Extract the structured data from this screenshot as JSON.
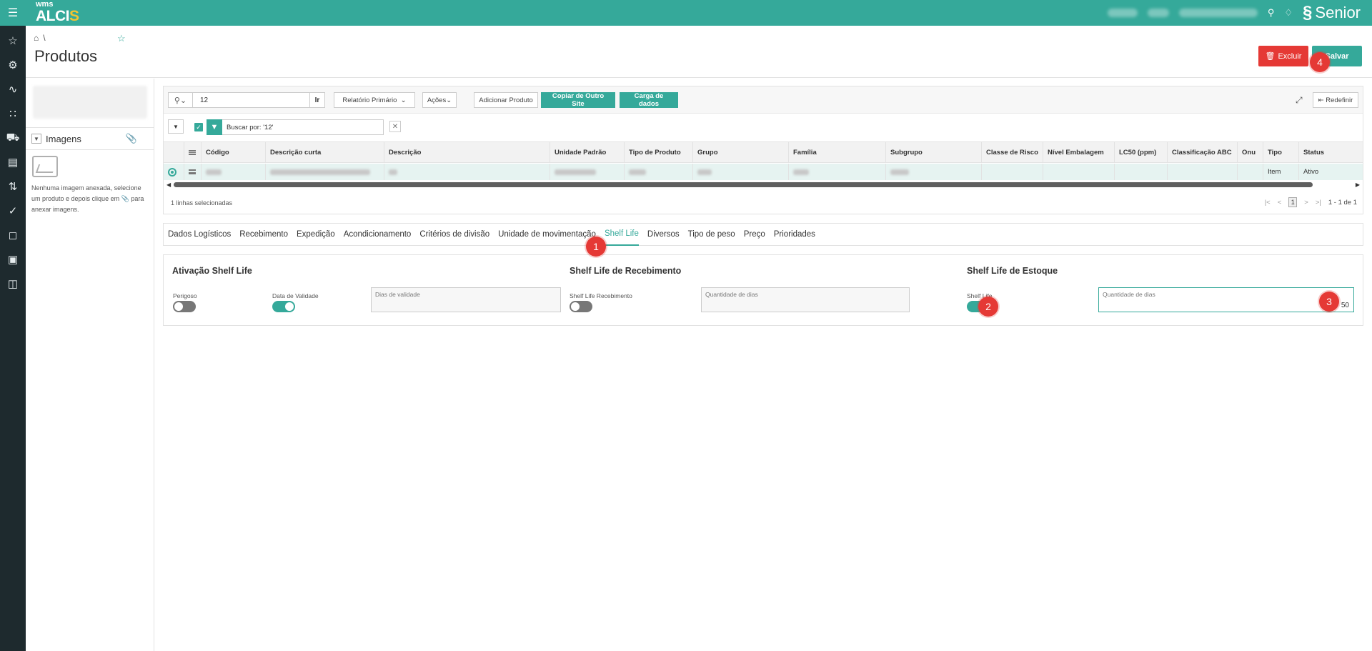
{
  "app": {
    "logo_small": "wms",
    "logo_big_a": "ALCI",
    "logo_big_b": "S",
    "brand": "Senior"
  },
  "colors": {
    "accent": "#35a99a",
    "danger": "#e53935",
    "rail": "#1e2a2e"
  },
  "header": {
    "title": "Produtos",
    "crumb_sep": "\\",
    "excluir_label": "Excluir",
    "salvar_label": "Salvar"
  },
  "rail": [
    "star-icon",
    "gear-icon",
    "chart-icon",
    "grid-icon",
    "truck-icon",
    "pallet-icon",
    "exchange-icon",
    "checklist-icon",
    "lock-icon",
    "archive-icon",
    "briefcase-icon"
  ],
  "left": {
    "images_title": "Imagens",
    "no_image_text_a": "Nenhuma imagem anexada, selecione um produto e depois clique em",
    "no_image_text_b": "para anexar imagens."
  },
  "toolbar": {
    "search_value": "12",
    "go_label": "Ir",
    "report_label": "Relatório Primário",
    "actions_label": "Ações",
    "add_product_label": "Adicionar Produto",
    "copy_site_label": "Copiar de Outro Site",
    "load_data_label": "Carga de dados",
    "reset_label": "Redefinir"
  },
  "filter": {
    "text": "Buscar por: '12'"
  },
  "grid": {
    "columns": [
      "Código",
      "Descrição curta",
      "Descrição",
      "Unidade Padrão",
      "Tipo de Produto",
      "Grupo",
      "Família",
      "Subgrupo",
      "Classe de Risco",
      "Nível Embalagem",
      "LC50 (ppm)",
      "Classificação ABC",
      "Onu",
      "Tipo",
      "Status"
    ],
    "row": {
      "tipo": "Item",
      "status": "Ativo"
    },
    "selected_info": "1 linhas selecionadas",
    "page_current": "1",
    "page_info": "1 - 1 de 1"
  },
  "tabs": [
    "Dados Logísticos",
    "Recebimento",
    "Expedição",
    "Acondicionamento",
    "Critérios de divisão",
    "Unidade de movimentação",
    "Shelf Life",
    "Diversos",
    "Tipo de peso",
    "Preço",
    "Prioridades"
  ],
  "active_tab": "Shelf Life",
  "shelf": {
    "activation_title": "Ativação Shelf Life",
    "perigoso_label": "Perigoso",
    "perigoso_on": false,
    "data_validade_label": "Data de Validade",
    "data_validade_on": true,
    "dias_validade_label": "Dias de validade",
    "receiving_title": "Shelf Life de Recebimento",
    "receiving_switch_label": "Shelf Life Recebimento",
    "receiving_on": false,
    "receiving_qty_label": "Quantidade de dias",
    "stock_title": "Shelf Life de Estoque",
    "stock_switch_label": "Shelf Life",
    "stock_on": true,
    "stock_qty_label": "Quantidade de dias",
    "stock_qty_value": "50"
  },
  "badges": [
    "1",
    "2",
    "3",
    "4"
  ]
}
